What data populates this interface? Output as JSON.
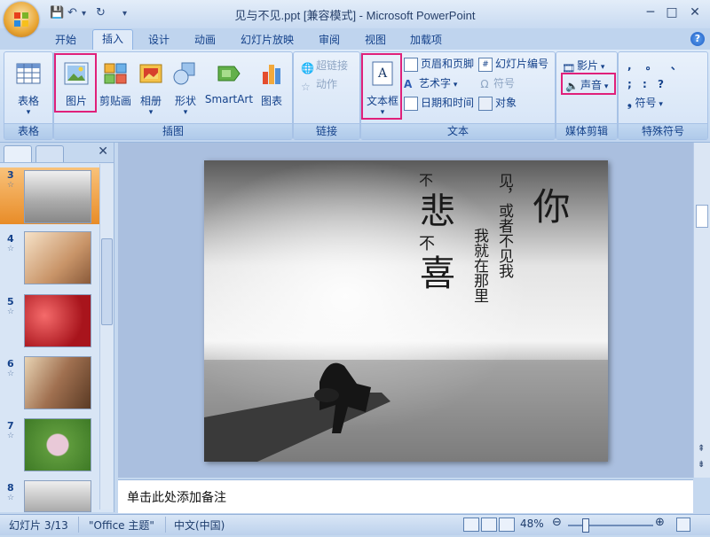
{
  "window": {
    "title": "见与不见.ppt [兼容模式] - Microsoft PowerPoint",
    "controls": {
      "minimize": "─",
      "maximize": "□",
      "close": "✕"
    }
  },
  "tabs": [
    "开始",
    "插入",
    "设计",
    "动画",
    "幻灯片放映",
    "审阅",
    "视图",
    "加载项"
  ],
  "active_tab": "插入",
  "ribbon": {
    "table_group": {
      "label": "表格",
      "table_btn": "表格"
    },
    "illustrations": {
      "label": "插图",
      "picture": "图片",
      "clipart": "剪贴画",
      "album": "相册",
      "shapes": "形状",
      "smartart": "SmartArt",
      "chart": "图表"
    },
    "links": {
      "label": "链接",
      "hyperlink": "超链接",
      "action": "动作"
    },
    "text": {
      "label": "文本",
      "textbox": "文本框",
      "header_footer": "页眉和页脚",
      "wordart": "艺术字",
      "datetime": "日期和时间",
      "slide_number": "幻灯片编号",
      "symbol": "符号",
      "object": "对象"
    },
    "media": {
      "label": "媒体剪辑",
      "movie": "影片",
      "sound": "声音"
    },
    "special": {
      "label": "特殊符号",
      "row1": ",  。 、",
      "row2": ";  :  ?",
      "symbol": "符号"
    }
  },
  "slides_panel": {
    "thumbs": [
      {
        "num": "3",
        "star": "☆"
      },
      {
        "num": "4",
        "star": "☆"
      },
      {
        "num": "5",
        "star": "☆"
      },
      {
        "num": "6",
        "star": "☆"
      },
      {
        "num": "7",
        "star": "☆"
      },
      {
        "num": "8",
        "star": "☆"
      }
    ]
  },
  "slide": {
    "col1_small": "不",
    "col1_big1": "悲",
    "col1_mid": "不",
    "col1_big2": "喜",
    "col2": "我就在那里",
    "col3": "见，或者不见我",
    "col4": "你"
  },
  "notes_placeholder": "单击此处添加备注",
  "status": {
    "slide_info": "幻灯片 3/13",
    "theme": "\"Office 主题\"",
    "language": "中文(中国)",
    "zoom": "48%"
  },
  "colors": {
    "highlight": "#e0207a",
    "ribbon": "#dfeaf8",
    "accent": "#15428b"
  }
}
